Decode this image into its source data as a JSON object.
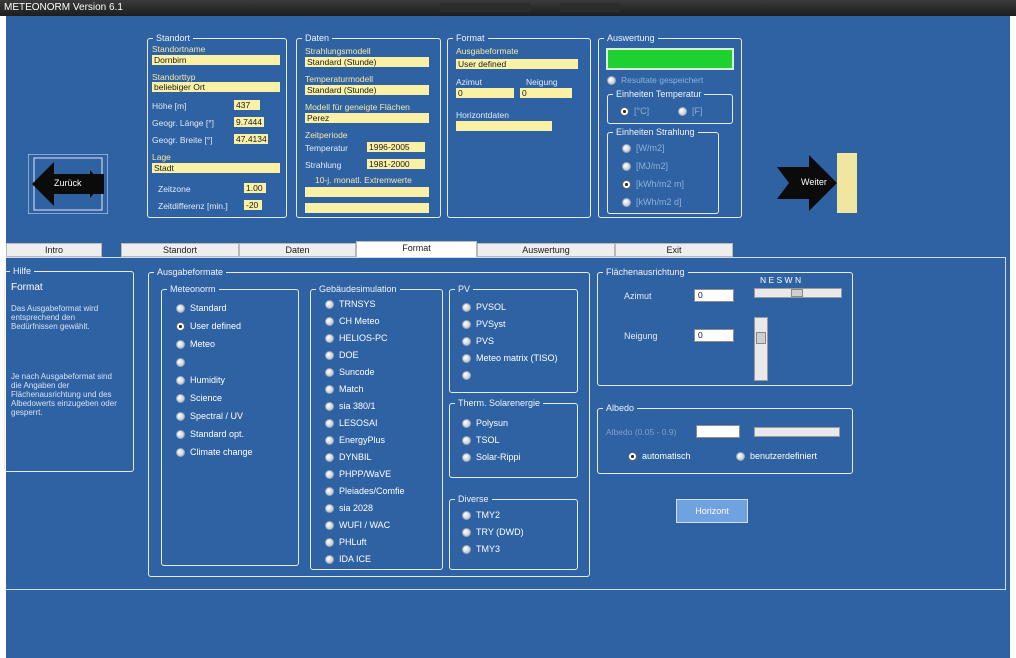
{
  "window": {
    "title": "METEONORM Version 6.1"
  },
  "standort": {
    "legend": "Standort",
    "name_label": "Standortname",
    "name_value": "Dornbirn",
    "typ_label": "Standorttyp",
    "typ_value": "beliebiger Ort",
    "hoehe_label": "Höhe [m]",
    "hoehe_value": "437",
    "laenge_label": "Geogr. Länge [°]",
    "laenge_value": "9.7444",
    "breite_label": "Geogr. Breite [°]",
    "breite_value": "47.4134",
    "lage_label": "Lage",
    "lage_value": "Stadt",
    "zeitzone_label": "Zeitzone",
    "zeitzone_value": "1.00",
    "zeitdiff_label": "Zeitdifferenz [min.]",
    "zeitdiff_value": "-20"
  },
  "daten": {
    "legend": "Daten",
    "strahlung_label": "Strahlungsmodell",
    "strahlung_value": "Standard (Stunde)",
    "temp_label": "Temperaturmodell",
    "temp_value": "Standard (Stunde)",
    "modell_label": "Modell für geneigte Flächen",
    "modell_value": "Perez",
    "zeitperiode_label": "Zeitperiode",
    "zp_temp_label": "Temperatur",
    "zp_temp_value": "1996-2005",
    "zp_strahl_label": "Strahlung",
    "zp_strahl_value": "1981-2000",
    "extrem_label": "10-j. monatl. Extremwerte"
  },
  "format_top": {
    "legend": "Format",
    "ausgabe_label": "Ausgabeformate",
    "ausgabe_value": "User defined",
    "azimut_label": "Azimut",
    "azimut_value": "0",
    "neigung_label": "Neigung",
    "neigung_value": "0",
    "horizont_label": "Horizontdaten"
  },
  "auswertung_top": {
    "legend": "Auswertung",
    "resultate_label": "Resultate gespeichert",
    "temp_legend": "Einheiten Temperatur",
    "temp_c": "[°C]",
    "temp_f": "[F]",
    "strahl_legend": "Einheiten Strahlung",
    "strahl_options": [
      "[W/m2]",
      "[MJ/m2]",
      "[kWh/m2 m]",
      "[kWh/m2 d]"
    ]
  },
  "nav": {
    "back_label": "Zurück",
    "next_label": "Weiter"
  },
  "tabs": [
    "Intro",
    "Standort",
    "Daten",
    "Format",
    "Auswertung",
    "Exit"
  ],
  "hilfe": {
    "legend": "Hilfe",
    "title": "Format",
    "text1": "Das Ausgabeformat wird entsprechend den Bedürfnissen gewählt.",
    "text2": "Je nach Ausgabeformat sind die Angaben der Flächenausrichtung und des Albedowerts einzugeben oder gesperrt."
  },
  "ausgabeformate": {
    "legend": "Ausgabeformate"
  },
  "meteonorm": {
    "legend": "Meteonorm",
    "options": [
      "Standard",
      "User defined",
      "Meteo",
      "",
      "Humidity",
      "Science",
      "Spectral / UV",
      "Standard opt.",
      "Climate change"
    ]
  },
  "gebaeude": {
    "legend": "Gebäudesimulation",
    "options": [
      "TRNSYS",
      "CH Meteo",
      "HELIOS-PC",
      "DOE",
      "Suncode",
      "Match",
      "sia 380/1",
      "LESOSAI",
      "EnergyPlus",
      "DYNBIL",
      "PHPP/WaVE",
      "Pleiades/Comfie",
      "sia 2028",
      "WUFI / WAC",
      "PHLuft",
      "IDA ICE"
    ]
  },
  "pv": {
    "legend": "PV",
    "options": [
      "PVSOL",
      "PVSyst",
      "PVS",
      "Meteo matrix (TISO)",
      ""
    ]
  },
  "therm": {
    "legend": "Therm. Solarenergie",
    "options": [
      "Polysun",
      "TSOL",
      "Solar-Rippi"
    ]
  },
  "diverse": {
    "legend": "Diverse",
    "options": [
      "TMY2",
      "TRY (DWD)",
      "TMY3"
    ]
  },
  "flaechen": {
    "legend": "Flächenausrichtung",
    "azimut_label": "Azimut",
    "azimut_value": "0",
    "neigung_label": "Neigung",
    "neigung_value": "0",
    "compass": "N  E  S  W  N"
  },
  "albedo": {
    "legend": "Albedo",
    "range_label": "Albedo (0.05 - 0.9)",
    "auto_label": "automatisch",
    "user_label": "benutzerdefiniert"
  },
  "horizont_button": "Horizont",
  "colors": {
    "background": "#2f62a3",
    "field": "#fbf1a6",
    "status_green": "#1fd031"
  }
}
